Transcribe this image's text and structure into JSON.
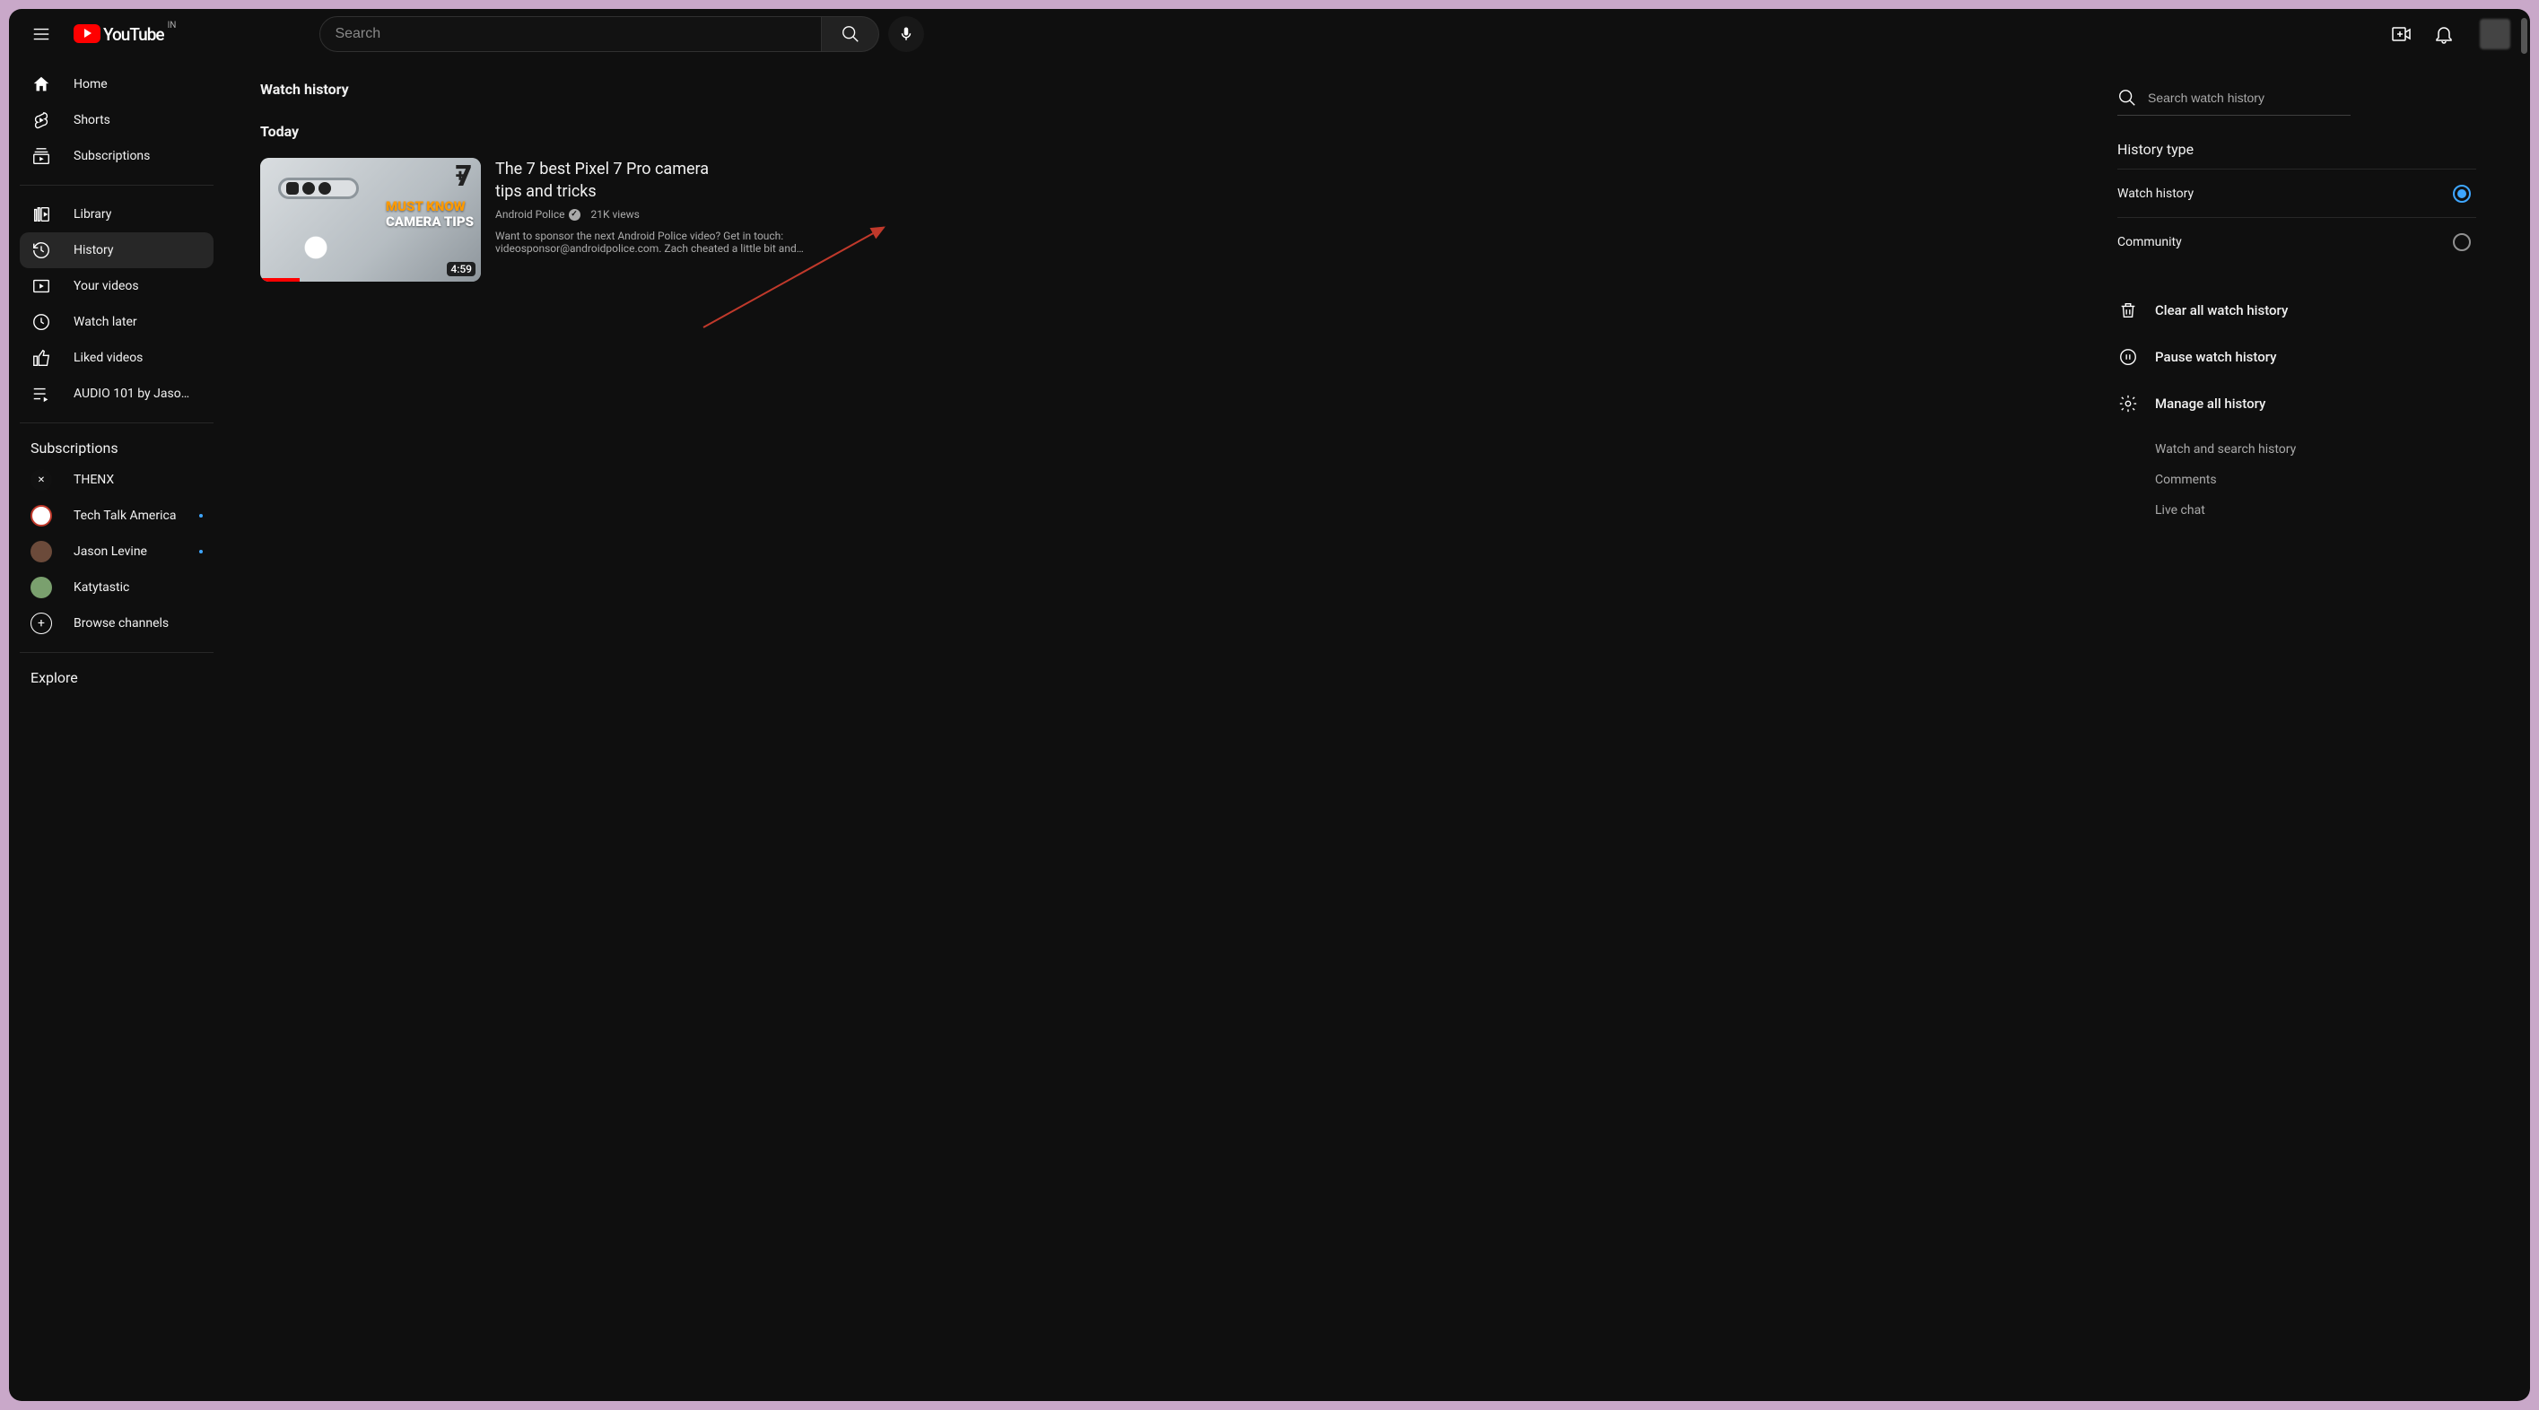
{
  "region": "IN",
  "brand": "YouTube",
  "search": {
    "placeholder": "Search"
  },
  "sidebar": {
    "primary": [
      {
        "label": "Home"
      },
      {
        "label": "Shorts"
      },
      {
        "label": "Subscriptions"
      }
    ],
    "secondary": [
      {
        "label": "Library"
      },
      {
        "label": "History"
      },
      {
        "label": "Your videos"
      },
      {
        "label": "Watch later"
      },
      {
        "label": "Liked videos"
      },
      {
        "label": "AUDIO 101 by Jaso…"
      }
    ],
    "subs_heading": "Subscriptions",
    "subs": [
      {
        "label": "THENX",
        "dot": false,
        "color": "#111"
      },
      {
        "label": "Tech Talk America",
        "dot": true,
        "color": "#fff"
      },
      {
        "label": "Jason Levine",
        "dot": true,
        "color": "#6b4a3a"
      },
      {
        "label": "Katytastic",
        "dot": false,
        "color": "#7aa06e"
      }
    ],
    "browse": "Browse channels",
    "explore": "Explore"
  },
  "page": {
    "title": "Watch history",
    "section": "Today",
    "video": {
      "title": "The 7 best Pixel 7 Pro camera tips and tricks",
      "channel": "Android Police",
      "views": "21K views",
      "duration": "4:59",
      "thumb_overlay_line1": "MUST KNOW",
      "thumb_overlay_line2": "CAMERA TIPS",
      "thumb_big": "7",
      "desc": "Want to sponsor the next Android Police video? Get in touch: videosponsor@androidpolice.com. Zach cheated a little bit and…"
    }
  },
  "panel": {
    "search_placeholder": "Search watch history",
    "heading": "History type",
    "types": [
      {
        "label": "Watch history",
        "checked": true
      },
      {
        "label": "Community",
        "checked": false
      }
    ],
    "actions": {
      "clear": "Clear all watch history",
      "pause": "Pause watch history",
      "manage": "Manage all history"
    },
    "manage_sub": [
      "Watch and search history",
      "Comments",
      "Live chat"
    ]
  }
}
